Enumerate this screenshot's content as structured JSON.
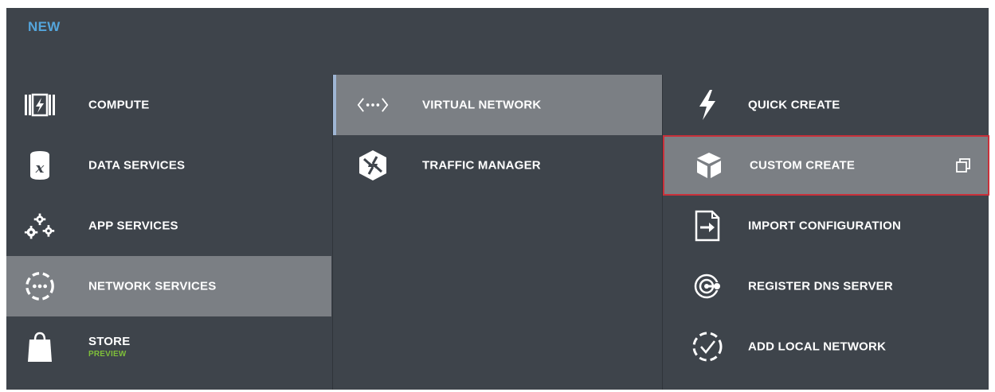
{
  "header": {
    "title": "NEW"
  },
  "categories": [
    {
      "label": "COMPUTE",
      "icon": "compute-icon"
    },
    {
      "label": "DATA SERVICES",
      "icon": "data-services-icon"
    },
    {
      "label": "APP SERVICES",
      "icon": "app-services-icon"
    },
    {
      "label": "NETWORK SERVICES",
      "icon": "network-services-icon",
      "selected": true
    },
    {
      "label": "STORE",
      "sublabel": "PREVIEW",
      "icon": "store-icon"
    }
  ],
  "network_services": [
    {
      "label": "VIRTUAL NETWORK",
      "icon": "virtual-network-icon",
      "selected": true
    },
    {
      "label": "TRAFFIC MANAGER",
      "icon": "traffic-manager-icon"
    }
  ],
  "actions": [
    {
      "label": "QUICK CREATE",
      "icon": "lightning-icon"
    },
    {
      "label": "CUSTOM CREATE",
      "icon": "package-icon",
      "selected": true,
      "trailing_icon": "popout-icon"
    },
    {
      "label": "IMPORT CONFIGURATION",
      "icon": "import-icon"
    },
    {
      "label": "REGISTER DNS SERVER",
      "icon": "dns-icon"
    },
    {
      "label": "ADD LOCAL NETWORK",
      "icon": "add-local-network-icon"
    }
  ],
  "colors": {
    "background": "#3e444b",
    "selected": "#7b7f84",
    "header": "#54a5dc",
    "preview": "#7fbf3a",
    "highlight_border": "#c9303a",
    "accent_bar": "#9fb6d4"
  }
}
